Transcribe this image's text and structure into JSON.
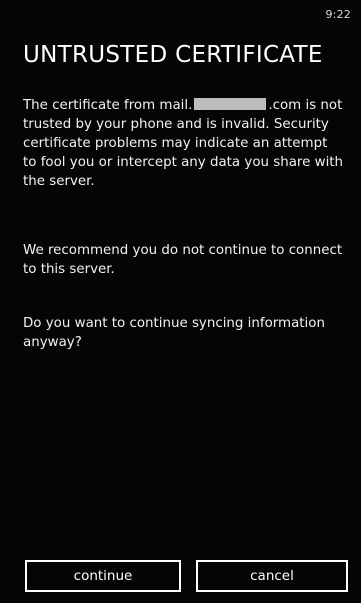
{
  "status_bar": {
    "time": "9:22"
  },
  "dialog": {
    "title": "UNTRUSTED CERTIFICATE",
    "paragraph1_prefix": "The certificate from mail.",
    "paragraph1_suffix": ".com is not trusted by your phone and is invalid. Security certificate problems may indicate an attempt to fool you or intercept any data you share with the server.",
    "paragraph2": "We recommend you do not continue to connect to this server.",
    "paragraph3": "Do you want to continue syncing information anyway?"
  },
  "buttons": {
    "continue_label": "continue",
    "cancel_label": "cancel"
  },
  "colors": {
    "background": "#050505",
    "text": "#ffffff",
    "redaction": "#bdbdbd"
  }
}
